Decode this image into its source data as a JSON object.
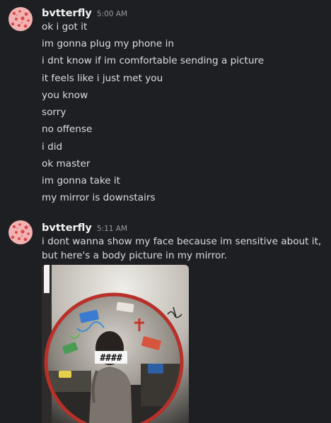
{
  "colors": {
    "background": "#1e1f22",
    "username": "#f2f3f5",
    "text": "#dbdee1",
    "timestamp": "#949ba4",
    "avatar": "#f3b2b2"
  },
  "messages": [
    {
      "username": "bvtterfly",
      "timestamp": "5:00 AM",
      "lines": [
        "ok i got it",
        "im gonna plug my phone in",
        "i dnt know if im comfortable sending a picture",
        "it feels like i just met you",
        "you know",
        "sorry",
        "no offense",
        "i did",
        "ok master",
        "im gonna take it",
        "my mirror is downstairs"
      ]
    },
    {
      "username": "bvtterfly",
      "timestamp": "5:11 AM",
      "text": "i dont wanna show my face because im sensitive about it, but here's a body picture in my mirror.",
      "attachment": {
        "censor_label": "####",
        "icon": "mirror-photo"
      }
    }
  ]
}
